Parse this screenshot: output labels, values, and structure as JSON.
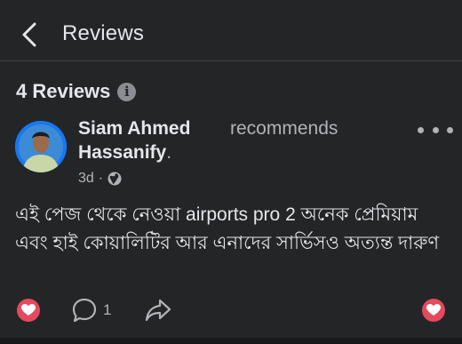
{
  "header": {
    "title": "Reviews"
  },
  "summary": {
    "count_label": "4 Reviews",
    "info_glyph": "i"
  },
  "review": {
    "author": "Siam Ahmed Hassanify",
    "author_suffix": ".",
    "verb": "recommends",
    "time": "3d",
    "separator": "·",
    "text": "এই পেজ থেকে নেওয়া airports pro 2 অনেক প্রেমিয়াম এবং হাই কোয়ালিটির আর এনাদের সার্ভিসও অত্যন্ত দারুণ",
    "comment_count": "1"
  },
  "colors": {
    "background": "#242526",
    "reaction": "#e4495e",
    "secondary_text": "#b0b3b8"
  },
  "icons": [
    "back-arrow-icon",
    "info-icon",
    "globe-icon",
    "more-options-icon",
    "heart-icon",
    "comment-icon",
    "share-icon"
  ]
}
